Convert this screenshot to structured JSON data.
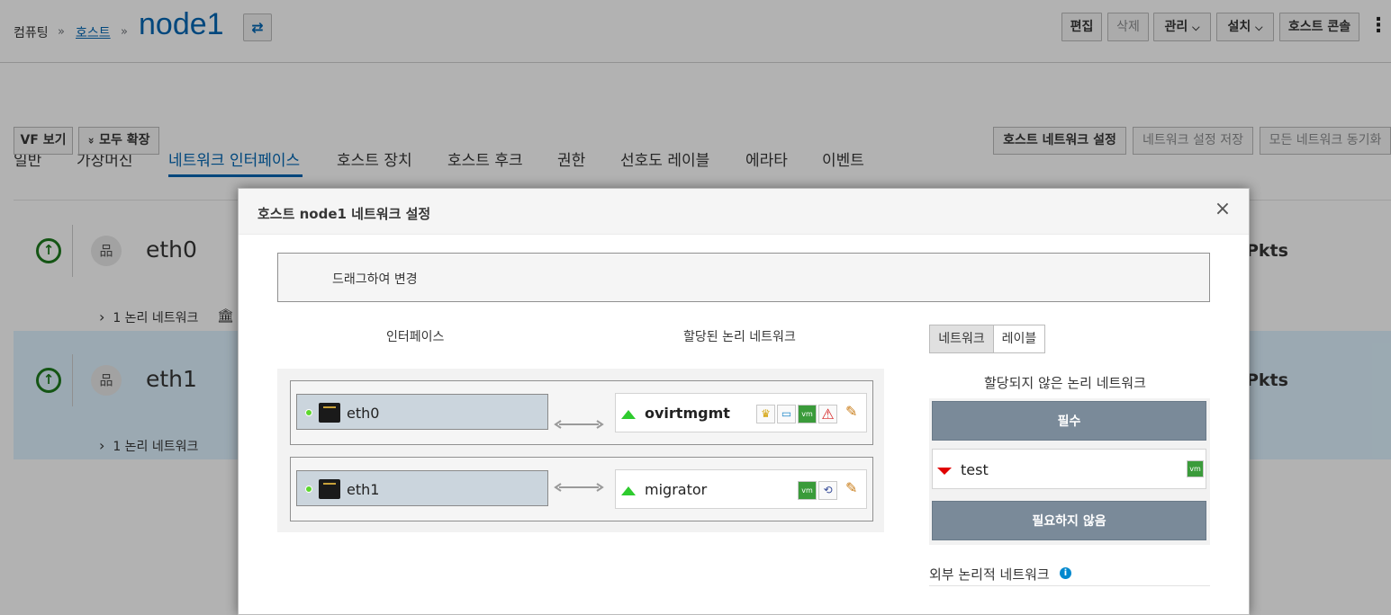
{
  "breadcrumb": {
    "root": "컴퓨팅",
    "hosts": "호스트",
    "separator": "»",
    "title": "node1",
    "swap_icon": "⇄"
  },
  "toolbar": {
    "edit": "편집",
    "delete": "삭제",
    "manage": "관리",
    "install": "설치",
    "host_console": "호스트 콘솔",
    "caret": "⌵",
    "kebab": "⋮"
  },
  "tabs": [
    "일반",
    "가상머신",
    "네트워크 인터페이스",
    "호스트 장치",
    "호스트 후크",
    "권한",
    "선호도 레이블",
    "에라타",
    "이벤트"
  ],
  "actions": {
    "vf_view": "VF 보기",
    "expand_all": "모두 확장",
    "expand_icon": "»",
    "setup_networks": "호스트 네트워크 설정",
    "save_network_config": "네트워크 설정 저장",
    "sync_all_networks": "모든 네트워크 동기화"
  },
  "nic_rows": [
    {
      "name": "eth0",
      "logical_networks": "1 논리 네트워크",
      "pkts": "Pkts",
      "status_icon": "up-arrow",
      "sub_icon": "bank-icon"
    },
    {
      "name": "eth1",
      "logical_networks": "1 논리 네트워크",
      "pkts": "Pkts",
      "status_icon": "up-arrow"
    }
  ],
  "chevron": "›",
  "modal": {
    "title": "호스트 node1 네트워크 설정",
    "close": "×",
    "drag_hint": "드래그하여 변경",
    "col_interfaces": "인터페이스",
    "col_assigned": "할당된 논리 네트워크",
    "toggle_network": "네트워크",
    "toggle_label": "레이블",
    "unassigned_title": "할당되지 않은 논리 네트워크",
    "required": "필수",
    "not_required": "필요하지 않음",
    "external_title": "외부 논리적 네트워크",
    "info_glyph": "i",
    "bonds": [
      {
        "nic": "eth0",
        "network": "ovirtmgmt",
        "network_bold": true,
        "icons": [
          "crown-icon",
          "monitor-icon",
          "vm-icon",
          "warning-icon"
        ],
        "status": "up"
      },
      {
        "nic": "eth1",
        "network": "migrator",
        "network_bold": false,
        "icons": [
          "vm-icon",
          "migration-icon"
        ],
        "status": "up"
      }
    ],
    "unassigned_networks": [
      {
        "name": "test",
        "status": "down",
        "icons": [
          "vm-icon"
        ]
      }
    ],
    "icon_glyphs": {
      "crown": "♛",
      "monitor": "▭",
      "vm": "vm",
      "warning": "⚠",
      "migration": "⟲",
      "pencil": "✎"
    }
  }
}
